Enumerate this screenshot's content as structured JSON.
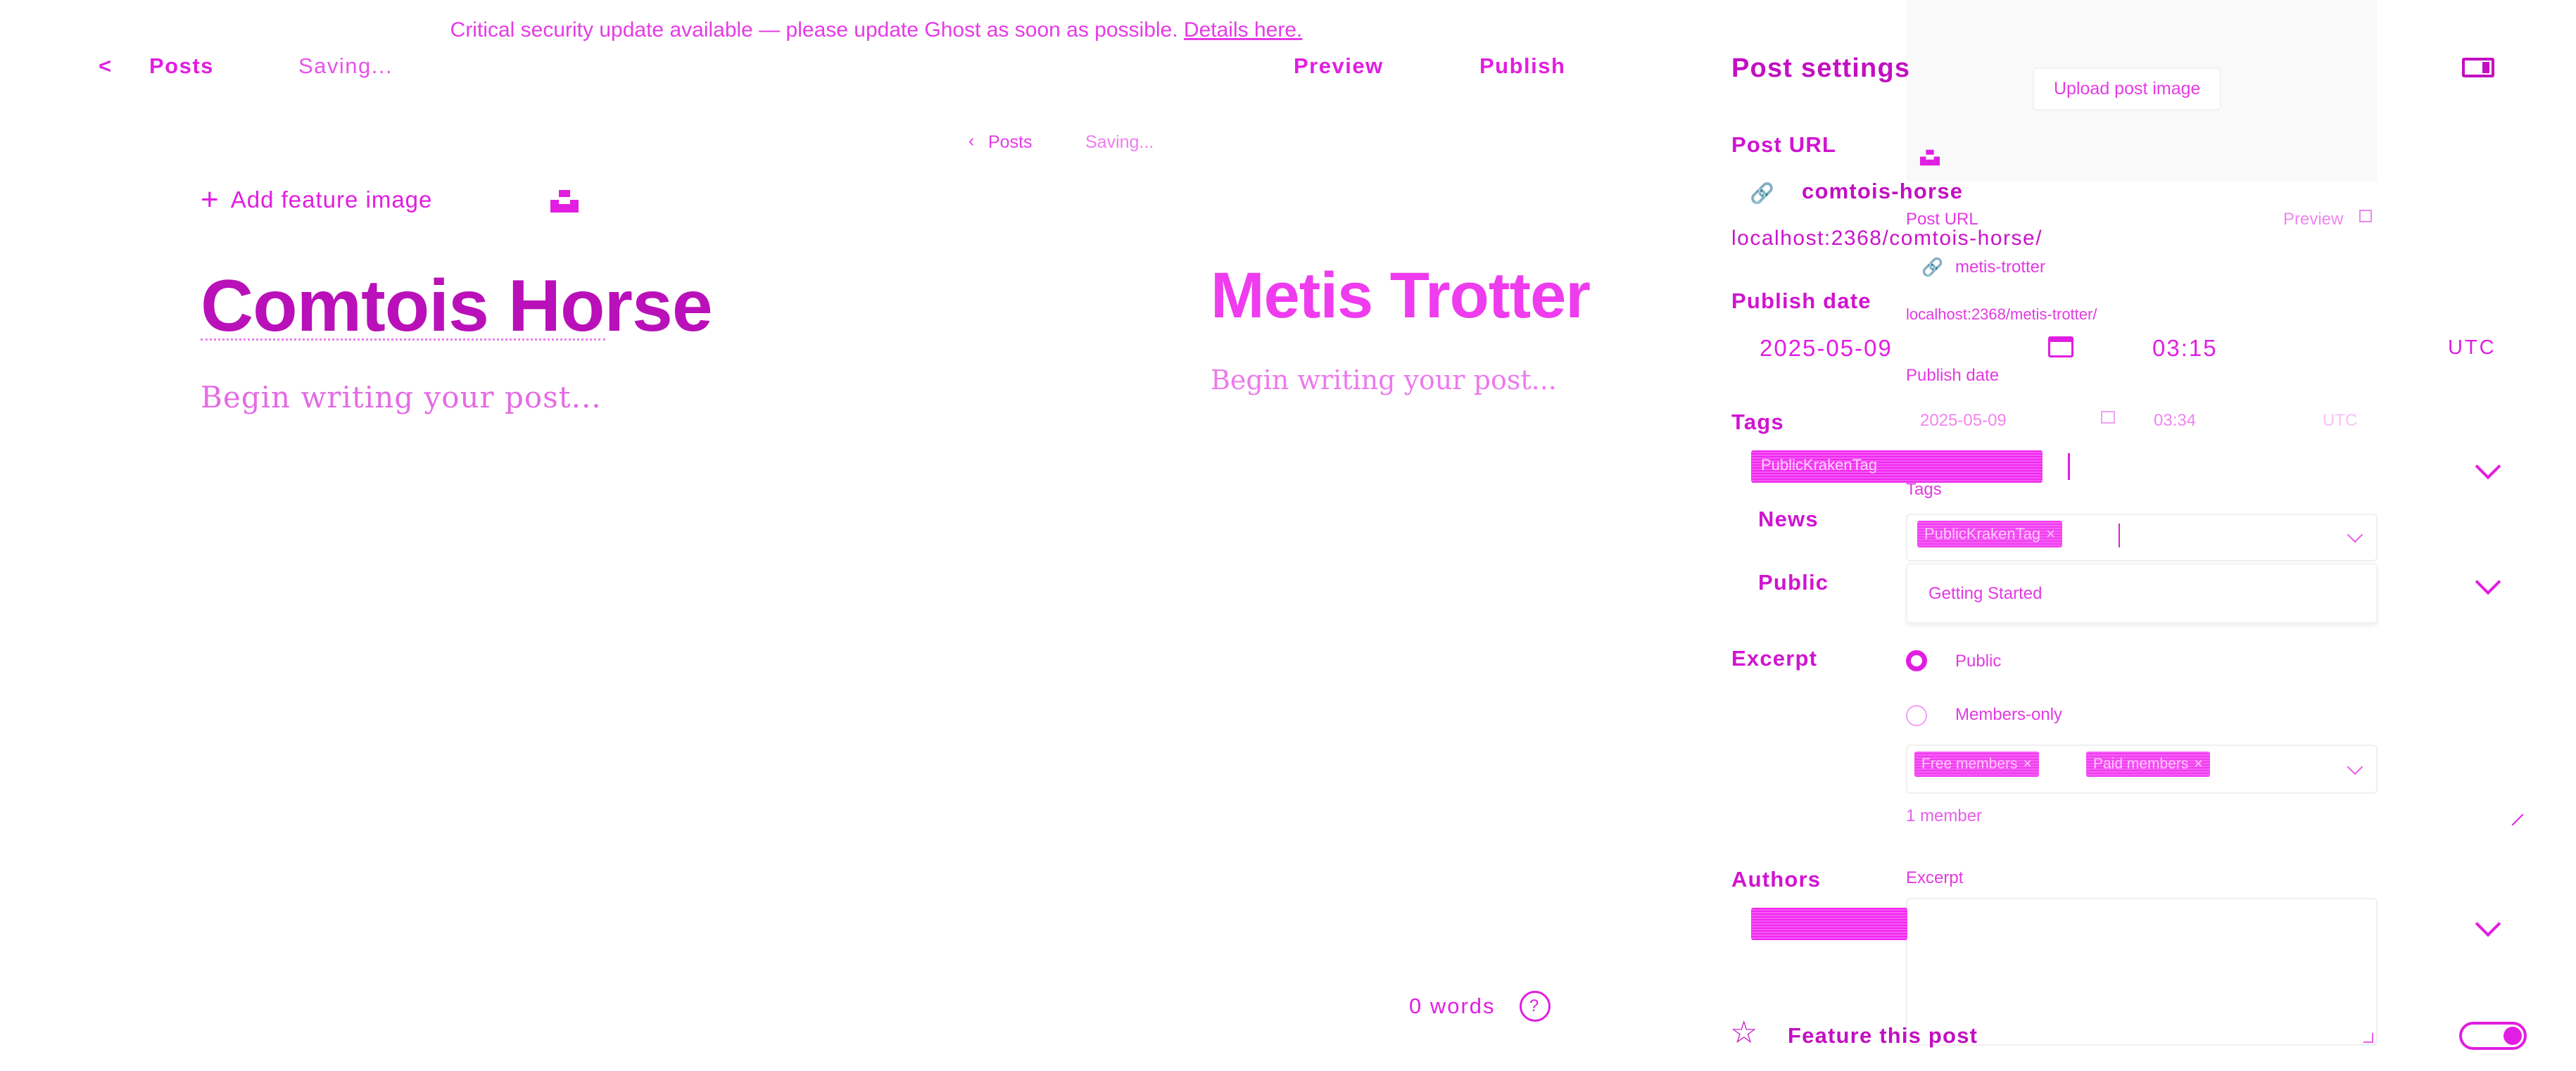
{
  "banner": {
    "text": "Critical security update available — please update Ghost as soon as possible.",
    "link": "Details here."
  },
  "header": {
    "back_label": "Posts",
    "status": "Saving...",
    "preview_label": "Preview",
    "publish_label": "Publish"
  },
  "ghost_header": {
    "back_label": "Posts",
    "status": "Saving..."
  },
  "editor": {
    "add_feature_image": "Add feature image",
    "title": "Comtois Horse",
    "body_placeholder": "Begin writing your post...",
    "word_count": "0 words",
    "help": "?"
  },
  "ghost_editor": {
    "title": "Metis Trotter",
    "body_placeholder": "Begin writing your post..."
  },
  "settings": {
    "title": "Post settings",
    "post_url_label": "Post URL",
    "slug": "comtois-horse",
    "full_url": "localhost:2368/comtois-horse/",
    "publish_date_label": "Publish date",
    "date": "2025-05-09",
    "time": "03:15",
    "timezone": "UTC",
    "tags_label": "Tags",
    "tags": [
      "PublicKrakenTag"
    ],
    "partial_news": "News",
    "partial_public": "Public",
    "excerpt_label": "Excerpt",
    "authors_label": "Authors",
    "feature_label": "Feature this post"
  },
  "ghost_settings": {
    "upload_image": "Upload post image",
    "post_url_label": "Post URL",
    "preview_label": "Preview",
    "slug": "metis-trotter",
    "full_url": "localhost:2368/metis-trotter/",
    "publish_date_label": "Publish date",
    "date": "2025-05-09",
    "time": "03:34",
    "timezone": "UTC",
    "tags_label": "Tags",
    "tag_pill": "PublicKrakenTag",
    "tag_suggestion": "Getting Started",
    "visibility_public": "Public",
    "visibility_members": "Members-only",
    "tier_free": "Free members",
    "tier_paid": "Paid members",
    "member_count": "1 member",
    "excerpt_label": "Excerpt"
  }
}
